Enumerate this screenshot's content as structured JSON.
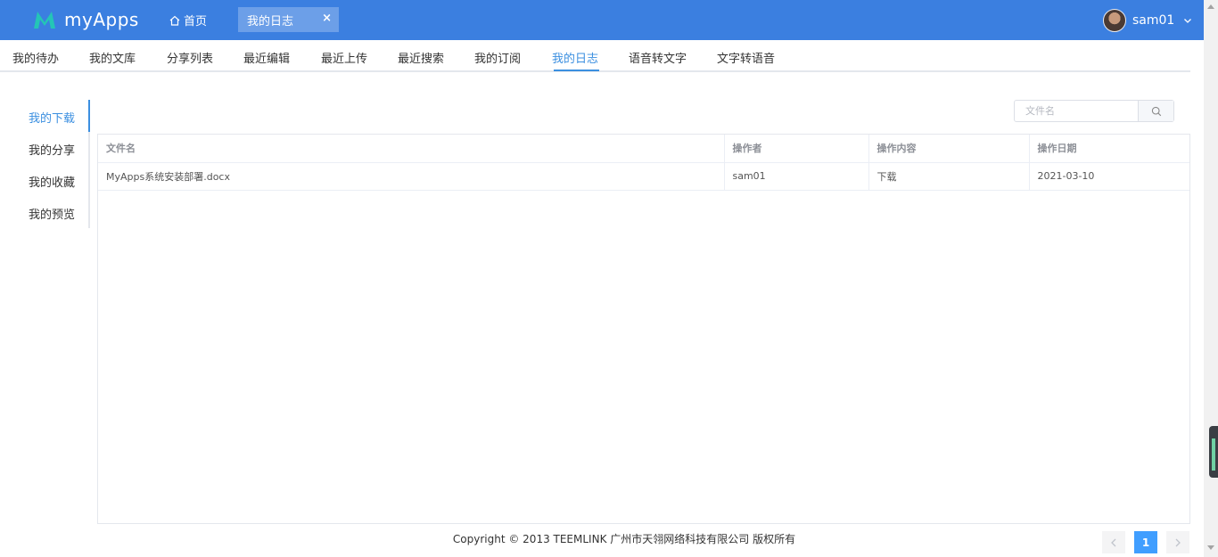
{
  "header": {
    "app_name": "myApps",
    "home_label": "首页",
    "active_tab_label": "我的日志",
    "tab_close_glyph": "×",
    "user_name": "sam01",
    "brand_color": "#3b7fe0",
    "logo_accent": "#24c5b6"
  },
  "nav": {
    "items": [
      "我的待办",
      "我的文库",
      "分享列表",
      "最近编辑",
      "最近上传",
      "最近搜索",
      "我的订阅",
      "我的日志",
      "语音转文字",
      "文字转语音"
    ],
    "active": "我的日志"
  },
  "sidebar": {
    "items": [
      "我的下载",
      "我的分享",
      "我的收藏",
      "我的预览"
    ],
    "active": "我的下载"
  },
  "search": {
    "placeholder": "文件名"
  },
  "table": {
    "columns": [
      "文件名",
      "操作者",
      "操作内容",
      "操作日期"
    ],
    "rows": [
      [
        "MyApps系统安装部署.docx",
        "sam01",
        "下载",
        "2021-03-10"
      ]
    ]
  },
  "footer": {
    "copyright": "Copyright © 2013 TEEMLINK 广州市天翎网络科技有限公司 版权所有"
  },
  "pagination": {
    "current_page": "1"
  }
}
